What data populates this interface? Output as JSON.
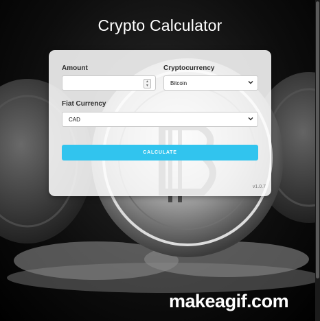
{
  "page": {
    "title": "Crypto Calculator"
  },
  "form": {
    "amount": {
      "label": "Amount",
      "value": "",
      "placeholder": ""
    },
    "cryptocurrency": {
      "label": "Cryptocurrency",
      "selected": "Bitcoin"
    },
    "fiat_currency": {
      "label": "Fiat Currency",
      "selected": "CAD"
    },
    "calculate_label": "CALCULATE",
    "version": "v1.0.7"
  },
  "watermark": "makeagif.com",
  "colors": {
    "accent": "#31c4ee",
    "card": "#ffffff",
    "background": "#000000"
  },
  "icons": {
    "select_arrow": "chevron-down-icon",
    "number_spinner": "spinner-icon"
  }
}
